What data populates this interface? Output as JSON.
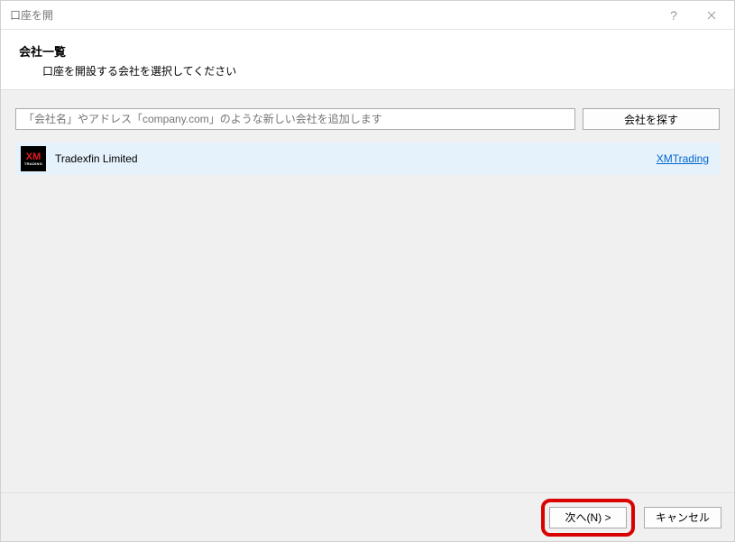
{
  "titleBar": {
    "title": "口座を開"
  },
  "header": {
    "title": "会社一覧",
    "subtitle": "口座を開設する会社を選択してください"
  },
  "search": {
    "placeholder": "「会社名」やアドレス「company.com」のような新しい会社を追加します",
    "buttonLabel": "会社を探す"
  },
  "companies": [
    {
      "name": "Tradexfin Limited",
      "link": "XMTrading"
    }
  ],
  "footer": {
    "nextLabel": "次へ(N) >",
    "cancelLabel": "キャンセル"
  }
}
